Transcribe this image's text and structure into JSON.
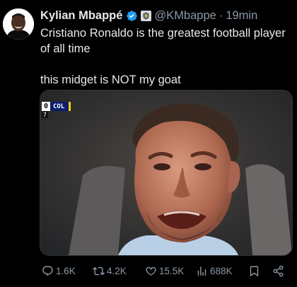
{
  "post": {
    "author_name": "Kylian Mbappé",
    "handle": "@KMbappe",
    "separator": "·",
    "time": "19min",
    "text_line1": "Cristiano Ronaldo is the greatest football player of all time",
    "text_line2": "this midget is NOT my goat",
    "verified": true,
    "verified_color": "#1d9bf0"
  },
  "media": {
    "scorebug": {
      "score": "0",
      "team": "COL",
      "time": "7"
    }
  },
  "actions": {
    "replies": "1.6K",
    "reposts": "4.2K",
    "likes": "15.5K",
    "views": "688K"
  },
  "icons": [
    "reply-icon",
    "repost-icon",
    "like-icon",
    "views-icon",
    "bookmark-icon",
    "share-icon"
  ]
}
